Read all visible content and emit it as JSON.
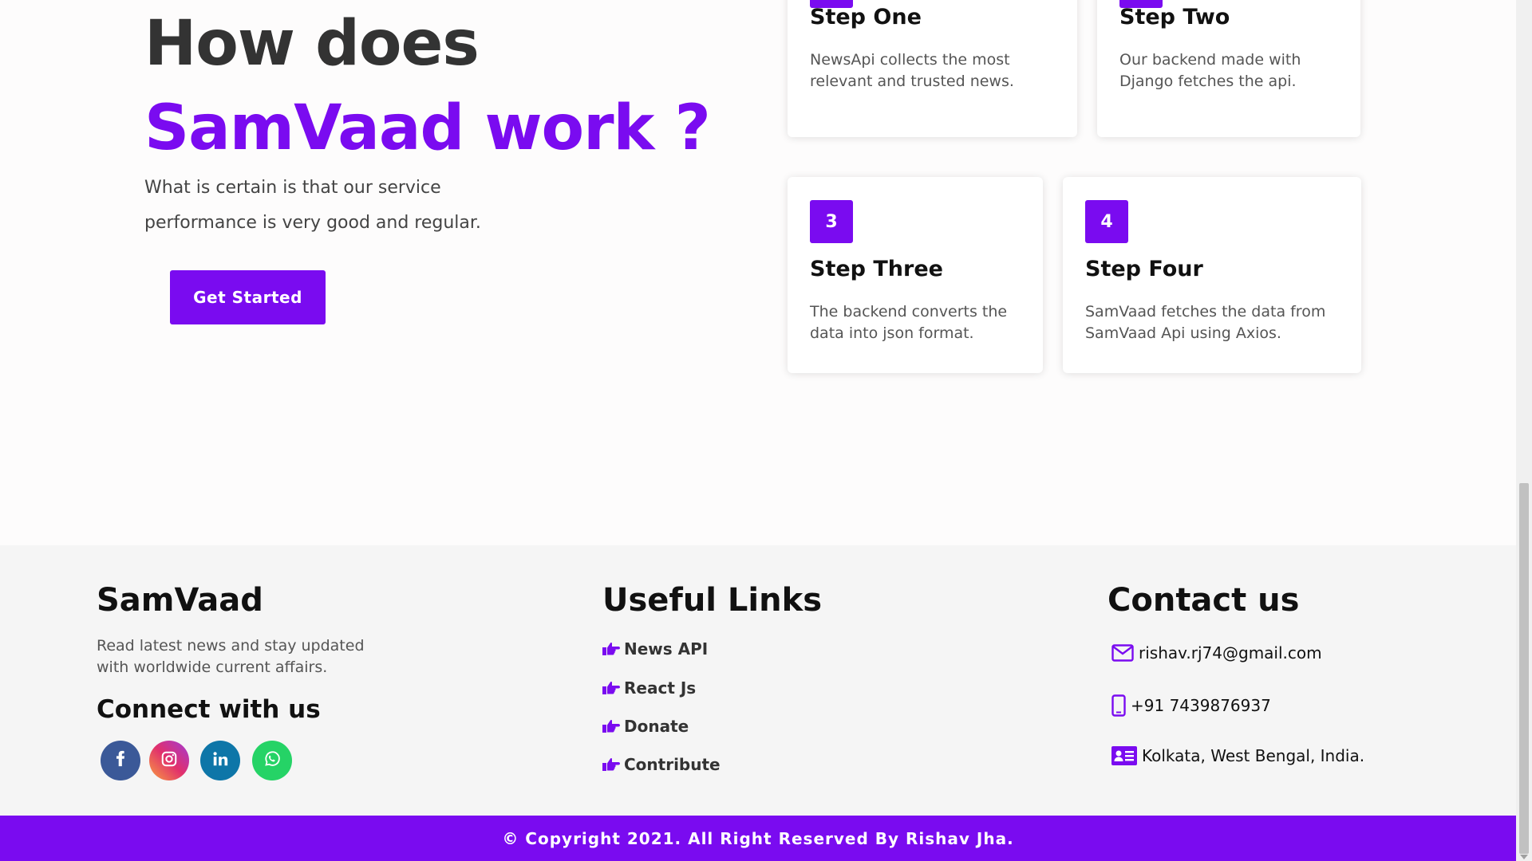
{
  "hero": {
    "title_line1": "How does",
    "title_line2": "SamVaad work ?",
    "description": "What is certain is that our service performance is very good and regular.",
    "button_label": "Get Started"
  },
  "steps": [
    {
      "number": "",
      "title": "Step One",
      "description": "NewsApi collects the most relevant and trusted news."
    },
    {
      "number": "",
      "title": "Step Two",
      "description": "Our backend made with Django fetches the api."
    },
    {
      "number": "3",
      "title": "Step Three",
      "description": "The backend converts the data into json format."
    },
    {
      "number": "4",
      "title": "Step Four",
      "description": "SamVaad fetches the data from SamVaad Api using Axios."
    }
  ],
  "footer": {
    "brand": "SamVaad",
    "about": "Read latest news and stay updated with worldwide current affairs.",
    "connect_title": "Connect with us",
    "social": [
      {
        "name": "facebook",
        "icon": "facebook-icon",
        "color": "#3b5998"
      },
      {
        "name": "instagram",
        "icon": "instagram-icon",
        "color": "#e1306c"
      },
      {
        "name": "linkedin",
        "icon": "linkedin-icon",
        "color": "#0e76a8"
      },
      {
        "name": "whatsapp",
        "icon": "whatsapp-icon",
        "color": "#25d366"
      }
    ],
    "links_title": "Useful Links",
    "links": [
      {
        "label": "News API",
        "icon": "hand-point-right-icon"
      },
      {
        "label": "React Js",
        "icon": "hand-point-right-icon"
      },
      {
        "label": "Donate",
        "icon": "hand-point-right-icon"
      },
      {
        "label": "Contribute",
        "icon": "hand-point-right-icon"
      }
    ],
    "contact_title": "Contact us",
    "contacts": [
      {
        "value": "rishav.rj74@gmail.com",
        "icon": "envelope-icon"
      },
      {
        "value": "+91 7439876937",
        "icon": "mobile-phone-icon"
      },
      {
        "value": "Kolkata, West Bengal, India.",
        "icon": "address-card-icon"
      }
    ],
    "copyright": "© Copyright 2021. All Right Reserved By Rishav Jha."
  },
  "colors": {
    "accent": "#7a0bf0",
    "heading": "#333333",
    "footer_bg": "#f5f5f5"
  }
}
